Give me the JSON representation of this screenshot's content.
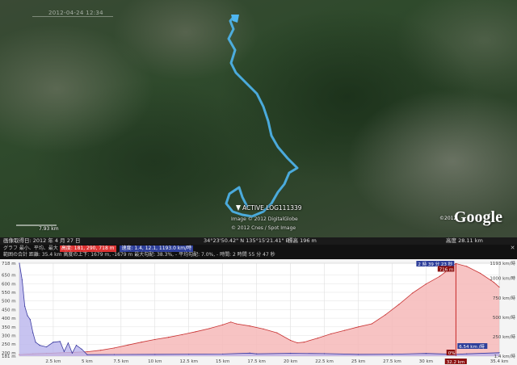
{
  "map": {
    "date_overlay": "2012-04-24 12:34",
    "track_label": "ACTIVE LOG111339",
    "credit_1": "Image © 2012 DigitalGlobe",
    "credit_2": "© 2012 Cnes / Spot Image",
    "copyright": "©2012",
    "brand": "Google",
    "scale_text": "7.93 km"
  },
  "statusbar": {
    "image_date": "画像取得日: 2012 年 4 月 27 日",
    "coords": "34°23'50.42\" N   135°15'21.41\" E",
    "elevation": "標高  196 m",
    "eye_alt": "高度   28.11 km"
  },
  "profile": {
    "line1_prefix": "グラフ 最小、平均、最大",
    "elev_stats": "高度: 181, 290, 718 m",
    "speed_stats": "速度: 1.4, 12.1, 1193.0 km/時",
    "line2": "範囲の合計 距離: 35.4 km  高度の上下: 1679 m, -1679 m  最大勾配: 38.3%, -  平均勾配: 7.0%, -  時間: 2 時間 55 分 47 秒",
    "close_icon": "close-icon",
    "cursor_time": "2 時 39 分 23 秒",
    "cursor_elev": "716 m",
    "cursor_speed": "6.54 km /時",
    "cursor_dist": "32.2 km",
    "cursor_grade": "0%"
  },
  "chart_data": {
    "type": "area",
    "title": "",
    "xlabel": "",
    "ylabel": "",
    "x_unit": "km",
    "xlim": [
      0,
      35.4
    ],
    "x_ticks": [
      "2.5 km",
      "5 km",
      "7.5 km",
      "10 km",
      "12.5 km",
      "15 km",
      "17.5 km",
      "20 km",
      "22.5 km",
      "25 km",
      "27.5 km",
      "30 km",
      "32.2 km",
      "35.4 km"
    ],
    "y_left_ticks": [
      "718 m",
      "650 m",
      "600 m",
      "550 m",
      "500 m",
      "450 m",
      "400 m",
      "350 m",
      "300 m",
      "250 m",
      "200 m",
      "181 m"
    ],
    "y_left_lim": [
      181,
      718
    ],
    "y_right_ticks": [
      "1193 km/時",
      "1000 km/時",
      "750 km/時",
      "500 km/時",
      "250 km/時",
      "1.4 km/時"
    ],
    "y_right_lim": [
      1.4,
      1193
    ],
    "grid": true,
    "series": [
      {
        "name": "高度",
        "axis": "left",
        "color": "#c83232",
        "fill": "#f6b8b8",
        "x": [
          0,
          1,
          2,
          3,
          4,
          5,
          6,
          7,
          8,
          9,
          10,
          11,
          12,
          13,
          14,
          15,
          15.6,
          16,
          17,
          18,
          19,
          20,
          20.5,
          21,
          22,
          23,
          24,
          25,
          26,
          27,
          28,
          29,
          30,
          31,
          31.5,
          32,
          32.2,
          33,
          34,
          35,
          35.4
        ],
        "y": [
          190,
          194,
          197,
          200,
          203,
          206,
          215,
          228,
          245,
          262,
          277,
          290,
          305,
          322,
          340,
          362,
          378,
          368,
          355,
          338,
          316,
          272,
          258,
          262,
          285,
          310,
          330,
          350,
          368,
          420,
          480,
          545,
          598,
          642,
          672,
          706,
          716,
          700,
          660,
          608,
          580
        ]
      },
      {
        "name": "速度",
        "axis": "right",
        "color": "#3a3aa0",
        "fill": "#b9b4ec",
        "x": [
          0,
          0.2,
          0.4,
          0.6,
          0.8,
          1.0,
          1.2,
          1.5,
          2,
          2.5,
          3,
          3.3,
          3.6,
          3.9,
          4.2,
          4.6,
          5,
          7,
          10,
          12.5,
          15,
          17,
          17.5,
          20,
          22.5,
          25,
          27.5,
          30,
          32.2,
          33,
          35.4
        ],
        "y": [
          1193,
          980,
          640,
          520,
          470,
          300,
          180,
          140,
          120,
          180,
          190,
          60,
          170,
          40,
          140,
          90,
          20,
          22,
          24,
          26,
          28,
          40,
          30,
          38,
          34,
          24,
          26,
          36,
          24,
          30,
          45
        ]
      }
    ]
  }
}
